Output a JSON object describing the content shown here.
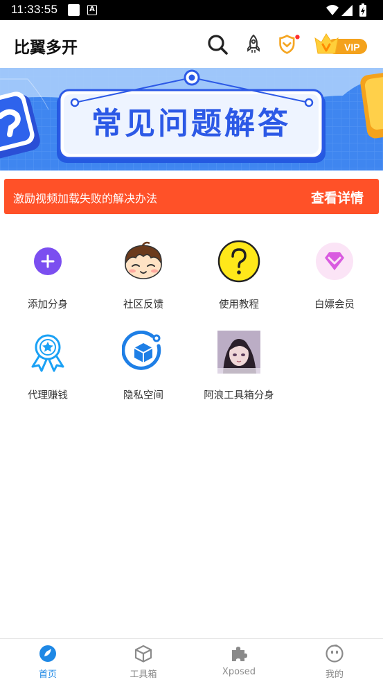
{
  "status_bar": {
    "time": "11:33:55",
    "icons": [
      "notification-square-icon",
      "font-a-icon",
      "wifi-icon",
      "signal-icon",
      "battery-charging-icon"
    ]
  },
  "header": {
    "title": "比翼多开",
    "vip_label": "VIP",
    "icons": [
      "search-icon",
      "rocket-icon",
      "shield-icon",
      "vip-crown-icon"
    ]
  },
  "banner": {
    "title": "常见问题解答"
  },
  "notice": {
    "text": "激励视频加载失败的解决办法",
    "link": "查看详情"
  },
  "grid": {
    "items": [
      {
        "label": "添加分身",
        "icon": "add-circle-icon"
      },
      {
        "label": "社区反馈",
        "icon": "cartoon-face-icon"
      },
      {
        "label": "使用教程",
        "icon": "question-mark-icon"
      },
      {
        "label": "白嫖会员",
        "icon": "diamond-icon"
      },
      {
        "label": "代理赚钱",
        "icon": "award-ribbon-icon"
      },
      {
        "label": "隐私空间",
        "icon": "privacy-cube-icon"
      },
      {
        "label": "阿浪工具箱分身",
        "icon": "app-avatar-thumbnail"
      }
    ]
  },
  "bottom_nav": {
    "items": [
      {
        "label": "首页",
        "icon": "home-icon",
        "active": true
      },
      {
        "label": "工具箱",
        "icon": "toolbox-cube-icon",
        "active": false
      },
      {
        "label": "Xposed",
        "icon": "puzzle-icon",
        "active": false
      },
      {
        "label": "我的",
        "icon": "profile-face-icon",
        "active": false
      }
    ]
  },
  "colors": {
    "accent": "#1e88e5",
    "notice_bg": "#ff5128",
    "banner_bg": "#3f86f0",
    "add_purple": "#7b4ef0"
  }
}
